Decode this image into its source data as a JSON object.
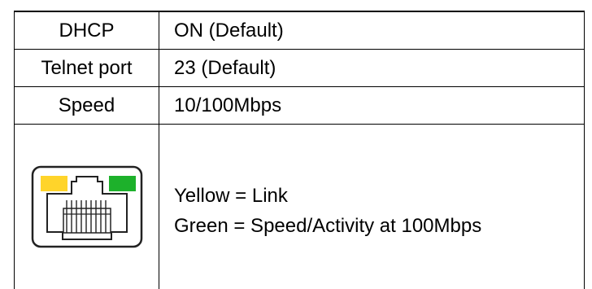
{
  "spec_rows": [
    {
      "key": "DHCP",
      "value": "ON (Default)"
    },
    {
      "key": "Telnet port",
      "value": "23 (Default)"
    },
    {
      "key": "Speed",
      "value": "10/100Mbps"
    }
  ],
  "led_legend": {
    "icon": "rj45-port-icon",
    "lines": [
      "Yellow = Link",
      "Green = Speed/Activity at 100Mbps"
    ]
  },
  "colors": {
    "link_led": "#FFD42A",
    "activity_led": "#1DB12B",
    "border": "#000000"
  }
}
